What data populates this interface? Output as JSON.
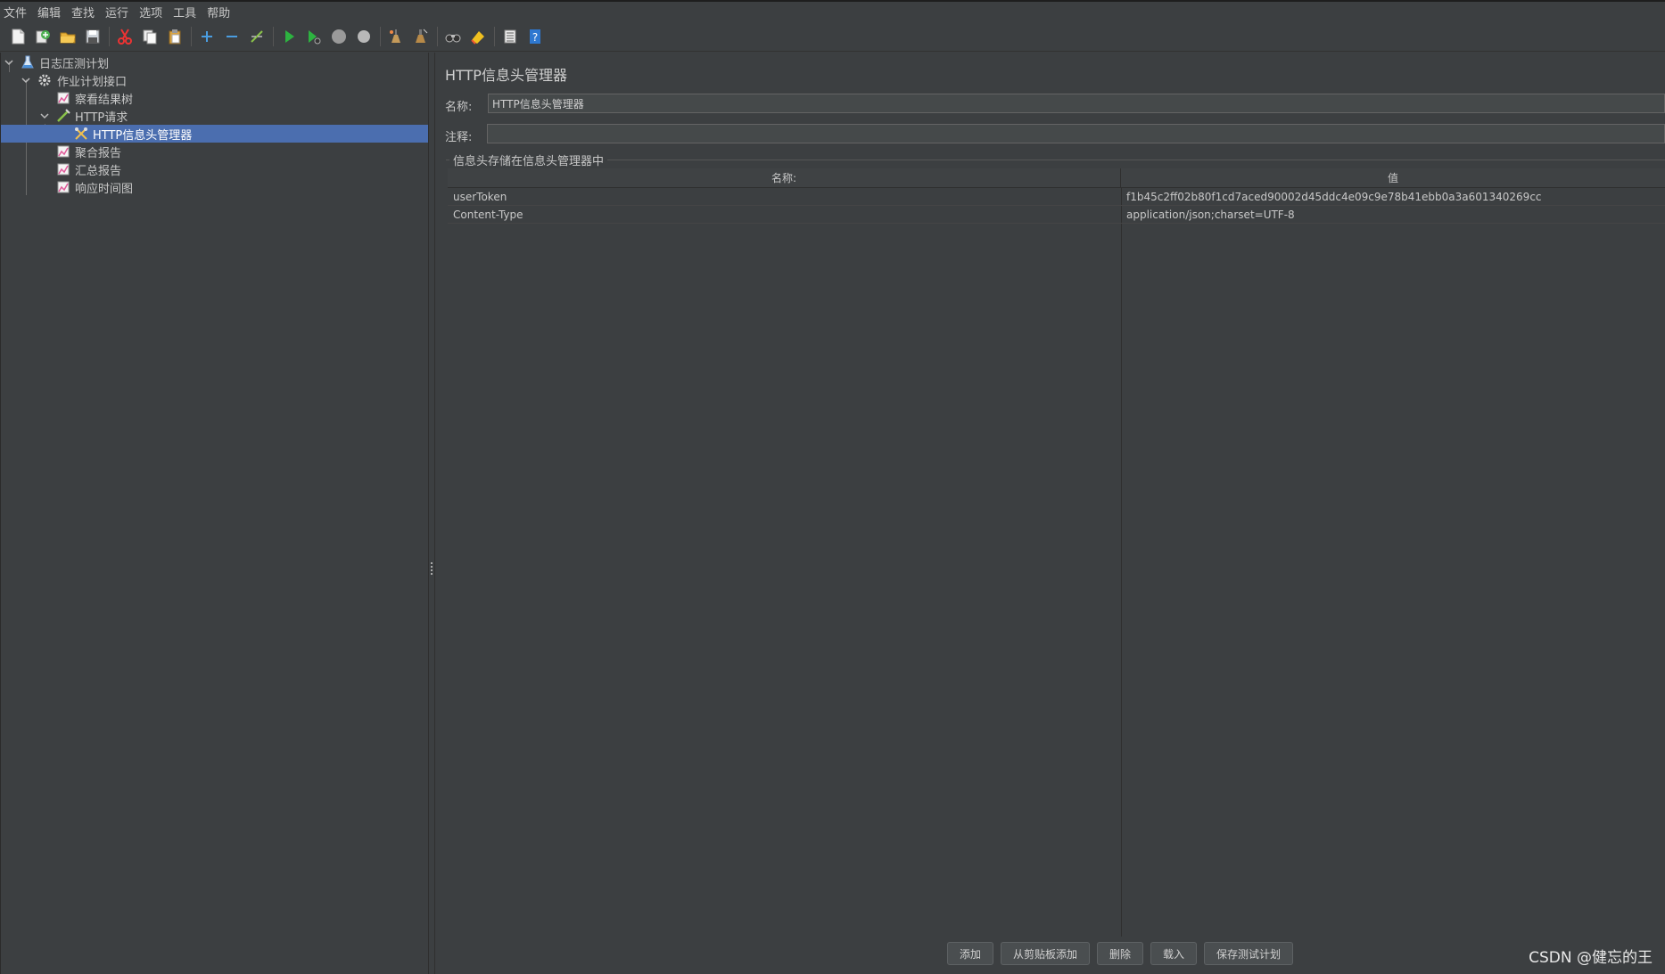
{
  "menu": [
    "文件",
    "编辑",
    "查找",
    "运行",
    "选项",
    "工具",
    "帮助"
  ],
  "toolbar_icons": [
    "new-icon",
    "templates-icon",
    "open-icon",
    "save-icon",
    "cut-icon",
    "copy-icon",
    "paste-icon",
    "expand-icon",
    "collapse-icon",
    "toggle-icon",
    "start-icon",
    "start-no-pause-icon",
    "stop-icon",
    "shutdown-icon",
    "clear-icon",
    "clear-all-icon",
    "search-icon",
    "reset-search-icon",
    "function-helper-icon",
    "help-icon"
  ],
  "tree": {
    "items": [
      {
        "label": "日志压测计划",
        "icon": "test-plan-icon"
      },
      {
        "label": "作业计划接口",
        "icon": "thread-group-icon"
      },
      {
        "label": "察看结果树",
        "icon": "listener-icon"
      },
      {
        "label": "HTTP请求",
        "icon": "sampler-icon"
      },
      {
        "label": "HTTP信息头管理器",
        "icon": "config-element-icon"
      },
      {
        "label": "聚合报告",
        "icon": "listener-icon"
      },
      {
        "label": "汇总报告",
        "icon": "listener-icon"
      },
      {
        "label": "响应时间图",
        "icon": "listener-icon"
      }
    ]
  },
  "panel": {
    "title": "HTTP信息头管理器",
    "name_label": "名称:",
    "name_value": "HTTP信息头管理器",
    "comment_label": "注释:",
    "comment_value": "",
    "group_title": "信息头存储在信息头管理器中"
  },
  "table": {
    "headers": [
      "名称:",
      "值"
    ],
    "rows": [
      [
        "userToken",
        "f1b45c2ff02b80f1cd7aced90002d45ddc4e09c9e78b41ebb0a3a601340269cc"
      ],
      [
        "Content-Type",
        "application/json;charset=UTF-8"
      ]
    ]
  },
  "buttons": {
    "add": "添加",
    "add_from_clipboard": "从剪贴板添加",
    "delete": "删除",
    "load": "载入",
    "save_test_plan": "保存测试计划"
  },
  "watermark": "CSDN @健忘的王",
  "colors": {
    "background": "#3c3f41",
    "selection": "#4b6eaf",
    "text": "#bbbbbb"
  }
}
